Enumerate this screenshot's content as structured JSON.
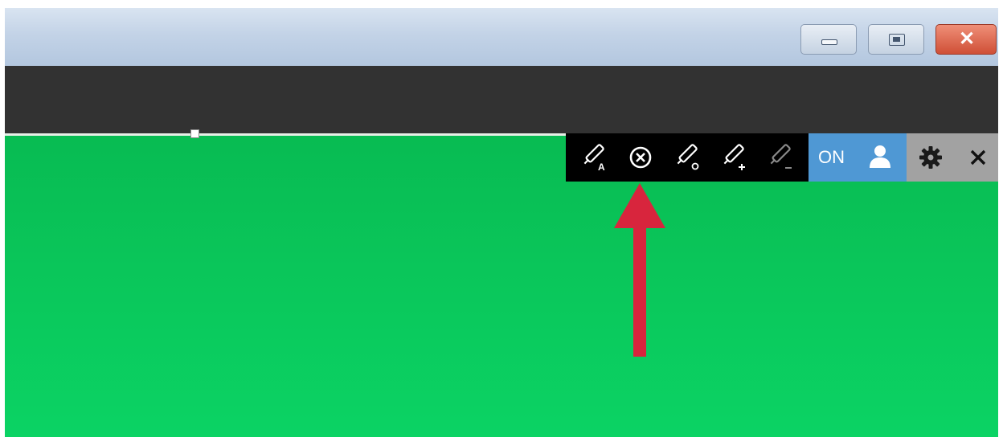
{
  "title_bar": {
    "minimize_icon": "minimize-icon",
    "maximize_icon": "maximize-icon",
    "close_icon": "close-window-icon",
    "close_glyph": "✕"
  },
  "tool_panel": {
    "tools": [
      {
        "icon": "eyedropper-auto-icon",
        "subscript": "A"
      },
      {
        "icon": "cancel-circle-icon"
      },
      {
        "icon": "eyedropper-circle-icon"
      },
      {
        "icon": "eyedropper-add-icon",
        "subscript": "+"
      },
      {
        "icon": "eyedropper-subtract-icon",
        "subscript": "−"
      }
    ],
    "toggle_label": "ON",
    "user_icon": "user-icon",
    "settings_icon": "gear-icon",
    "close_glyph": "✕"
  },
  "colors": {
    "chroma_green": "#0ac65a",
    "toggle_blue": "#4f98d4",
    "arrow_red": "#d8253d",
    "toolbar_black": "#000000",
    "header_dark": "#323232"
  }
}
